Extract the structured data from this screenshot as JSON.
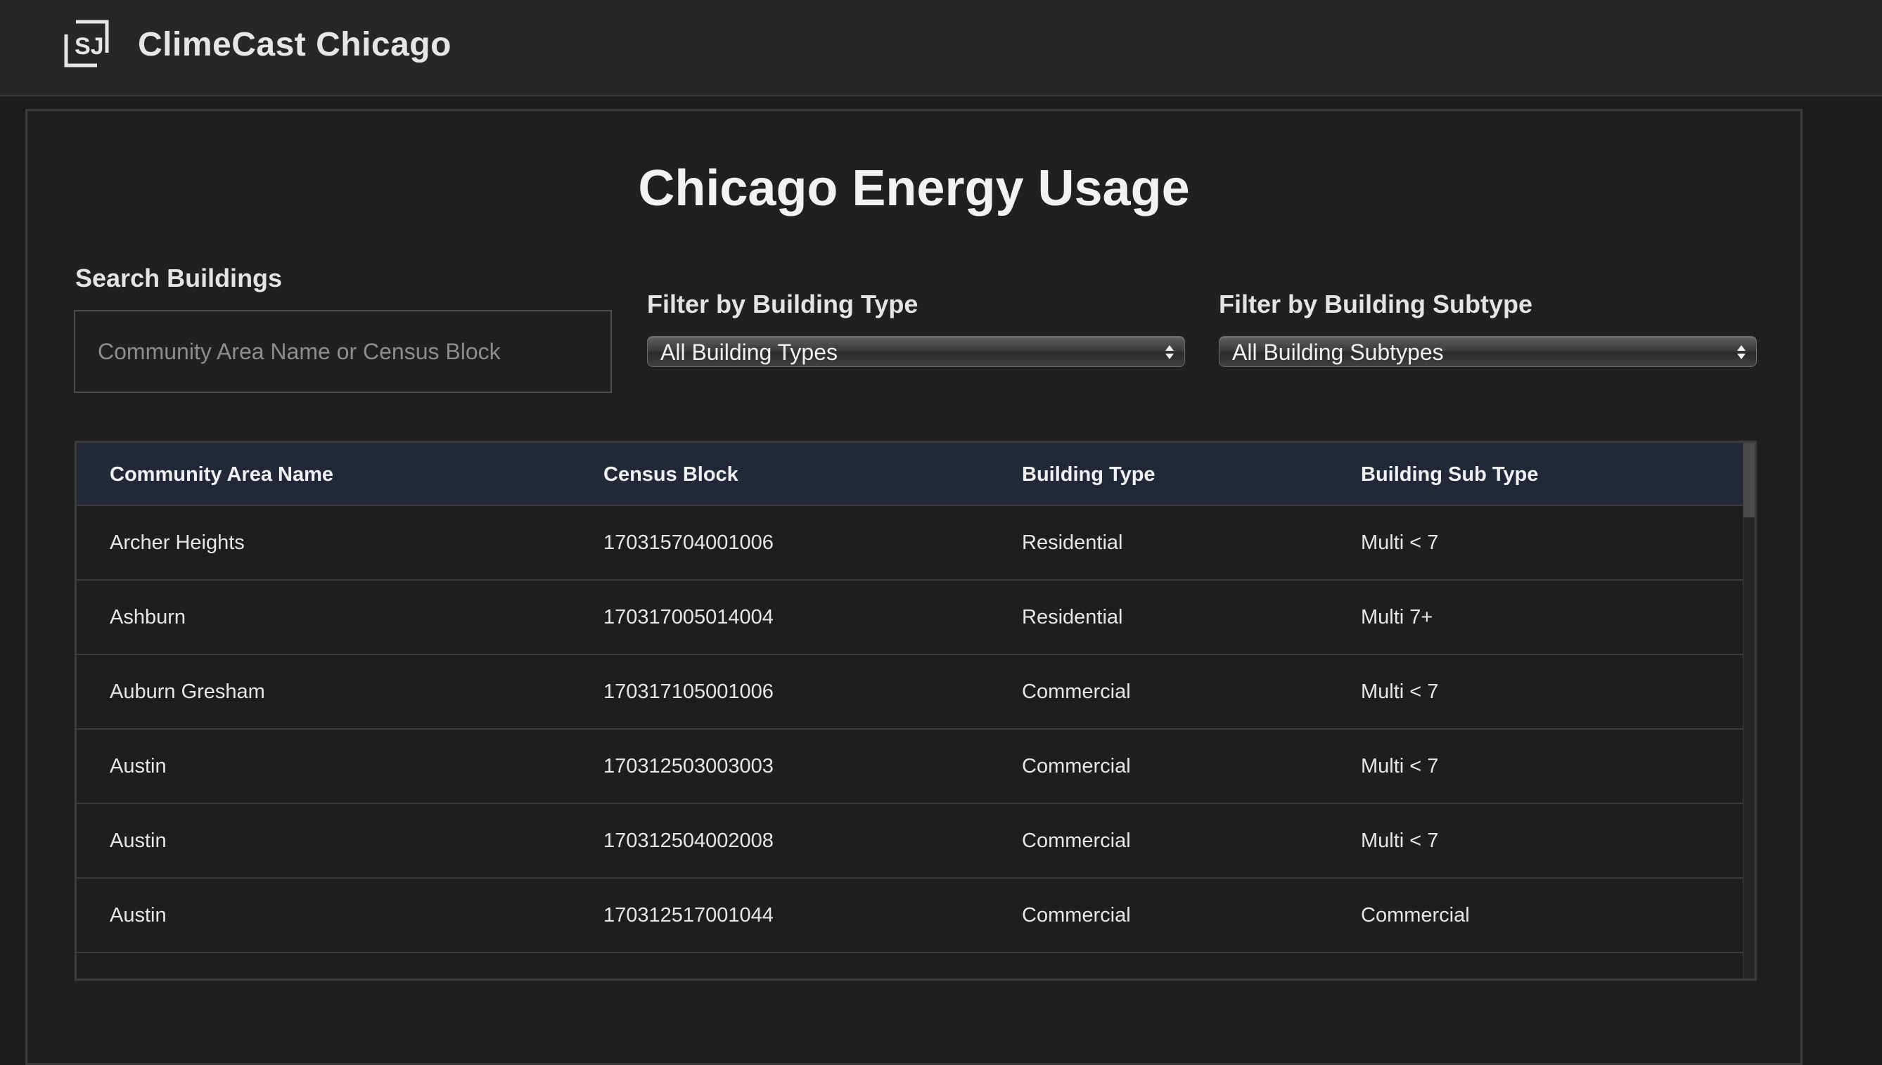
{
  "app": {
    "title": "ClimeCast Chicago",
    "logo_icon": "sj-logo-icon"
  },
  "page": {
    "title": "Chicago Energy Usage"
  },
  "search": {
    "label": "Search Buildings",
    "placeholder": "Community Area Name or Census Block",
    "value": ""
  },
  "filters": {
    "type_label": "Filter by Building Type",
    "type_selected": "All Building Types",
    "subtype_label": "Filter by Building Subtype",
    "subtype_selected": "All Building Subtypes"
  },
  "table": {
    "columns": [
      "Community Area Name",
      "Census Block",
      "Building Type",
      "Building Sub Type"
    ],
    "rows": [
      [
        "Archer Heights",
        "170315704001006",
        "Residential",
        "Multi < 7"
      ],
      [
        "Ashburn",
        "170317005014004",
        "Residential",
        "Multi 7+"
      ],
      [
        "Auburn Gresham",
        "170317105001006",
        "Commercial",
        "Multi < 7"
      ],
      [
        "Austin",
        "170312503003003",
        "Commercial",
        "Multi < 7"
      ],
      [
        "Austin",
        "170312504002008",
        "Commercial",
        "Multi < 7"
      ],
      [
        "Austin",
        "170312517001044",
        "Commercial",
        "Commercial"
      ]
    ]
  },
  "colors": {
    "header_bg": "#272727",
    "panel_bg": "#202020",
    "table_header_bg": "#222838"
  }
}
